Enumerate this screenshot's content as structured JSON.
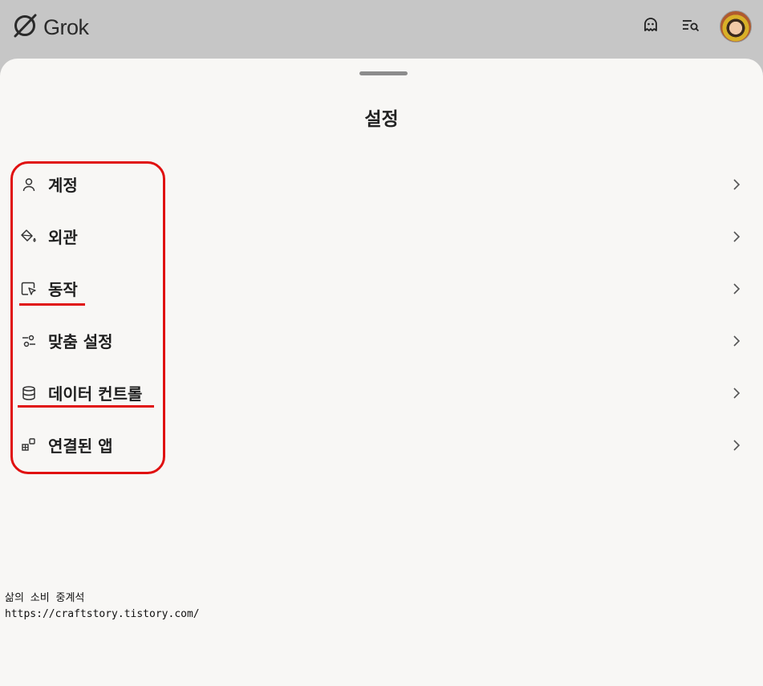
{
  "app": {
    "name": "Grok"
  },
  "topbar": {
    "icons": [
      "ghost-icon",
      "search-list-icon"
    ]
  },
  "sheet": {
    "title": "설정"
  },
  "menu": [
    {
      "label": "계정",
      "icon": "user-icon"
    },
    {
      "label": "외관",
      "icon": "paint-bucket-icon"
    },
    {
      "label": "동작",
      "icon": "cursor-window-icon"
    },
    {
      "label": "맞춤 설정",
      "icon": "sliders-icon"
    },
    {
      "label": "데이터 컨트롤",
      "icon": "database-icon"
    },
    {
      "label": "연결된 앱",
      "icon": "apps-grid-icon"
    }
  ],
  "annotation": {
    "color": "#e01010"
  },
  "watermark": {
    "line1": "삶의 소비 중계석",
    "line2": "https://craftstory.tistory.com/"
  }
}
